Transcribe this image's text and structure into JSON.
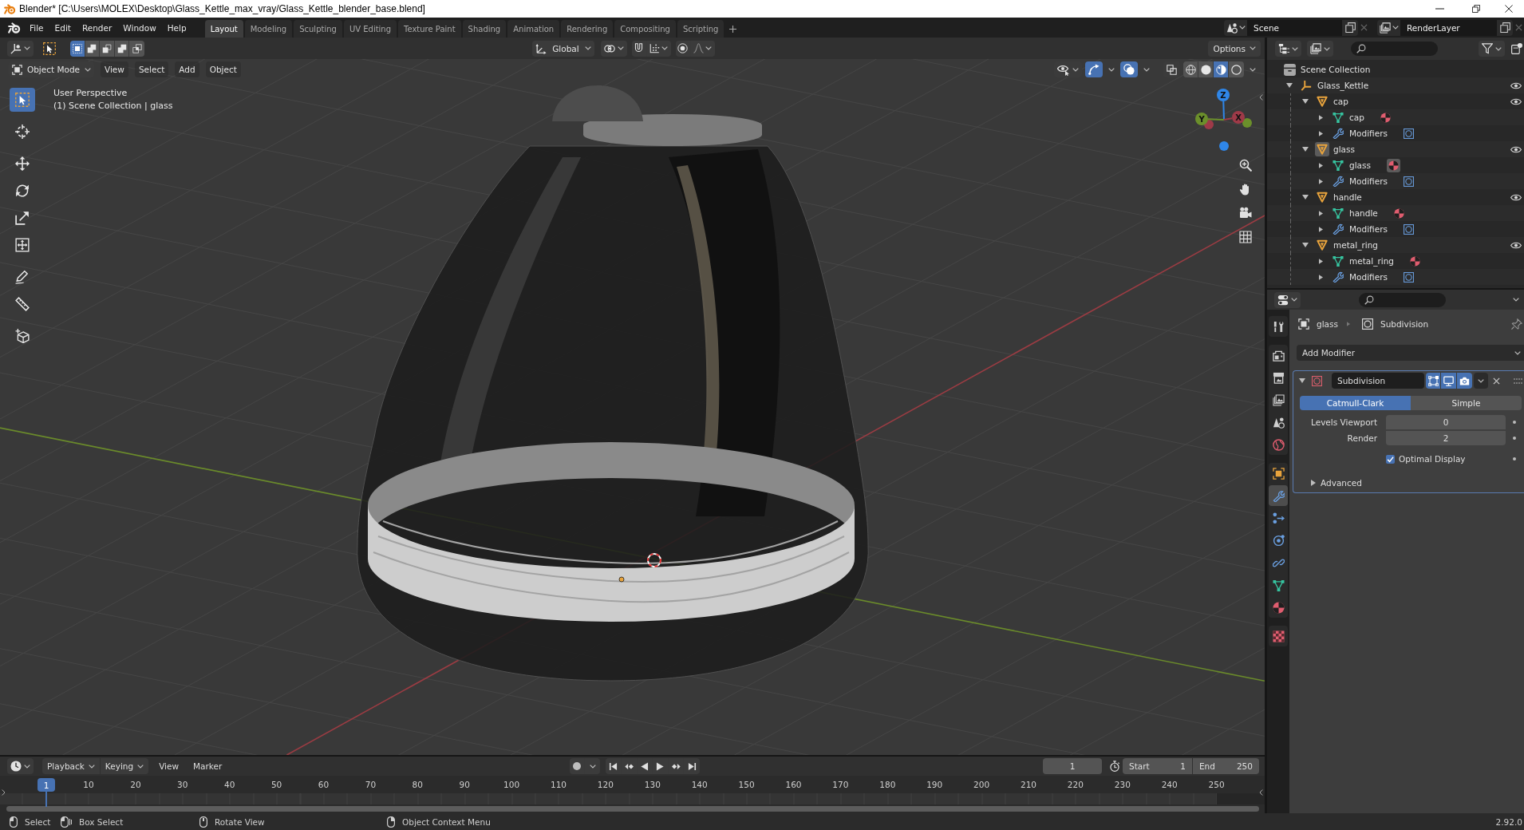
{
  "window": {
    "title": "Blender* [C:\\Users\\MOLEX\\Desktop\\Glass_Kettle_max_vray/Glass_Kettle_blender_base.blend]"
  },
  "menu": [
    "File",
    "Edit",
    "Render",
    "Window",
    "Help"
  ],
  "workspaces": [
    {
      "label": "Layout",
      "selected": true
    },
    {
      "label": "Modeling",
      "selected": false
    },
    {
      "label": "Sculpting",
      "selected": false
    },
    {
      "label": "UV Editing",
      "selected": false
    },
    {
      "label": "Texture Paint",
      "selected": false
    },
    {
      "label": "Shading",
      "selected": false
    },
    {
      "label": "Animation",
      "selected": false
    },
    {
      "label": "Rendering",
      "selected": false
    },
    {
      "label": "Compositing",
      "selected": false
    },
    {
      "label": "Scripting",
      "selected": false
    }
  ],
  "scene": {
    "name": "Scene",
    "view_layer": "RenderLayer"
  },
  "tool_settings": {
    "select_modes": [
      {
        "kind": "set",
        "selected": true
      },
      {
        "kind": "extend",
        "selected": false
      },
      {
        "kind": "subtract",
        "selected": false
      },
      {
        "kind": "difference",
        "selected": false
      },
      {
        "kind": "intersect",
        "selected": false
      }
    ],
    "orientation": "Global",
    "options": "Options"
  },
  "viewport": {
    "mode": "Object Mode",
    "menus": [
      "View",
      "Select",
      "Add",
      "Object"
    ],
    "gizmos": true,
    "overlays": true,
    "xray": false,
    "shading": [
      {
        "kind": "wireframe",
        "selected": false
      },
      {
        "kind": "solid",
        "selected": false
      },
      {
        "kind": "material",
        "selected": true
      },
      {
        "kind": "rendered",
        "selected": false
      }
    ],
    "toolbar": [
      [
        {
          "kind": "select_box",
          "selected": true
        }
      ],
      [
        {
          "kind": "cursor",
          "selected": false
        }
      ],
      [
        {
          "kind": "move",
          "selected": false
        },
        {
          "kind": "rotate",
          "selected": false
        },
        {
          "kind": "scale",
          "selected": false
        },
        {
          "kind": "transform",
          "selected": false
        }
      ],
      [
        {
          "kind": "annotate",
          "selected": false
        },
        {
          "kind": "measure",
          "selected": false
        }
      ],
      [
        {
          "kind": "add_cube",
          "selected": false
        }
      ]
    ],
    "info": [
      "User Perspective",
      "(1) Scene Collection | glass"
    ],
    "navigation_gizmo": {
      "axes": [
        {
          "label": "X",
          "color": "#9e3a48"
        },
        {
          "label": "Y",
          "color": "#6b8f2b"
        },
        {
          "label": "Z",
          "color": "#2f86e8"
        }
      ]
    }
  },
  "outliner": {
    "root": {
      "label": "Scene Collection",
      "children": [
        {
          "kind": "empty",
          "label": "Glass_Kettle",
          "expanded": true,
          "visible": true,
          "active": false,
          "children": [
            {
              "kind": "object",
              "label": "cap",
              "expanded": true,
              "visible": true,
              "active": false,
              "children": [
                {
                  "kind": "mesh",
                  "label": "cap",
                  "expanded": false,
                  "active": false
                },
                {
                  "kind": "modifiers",
                  "label": "Modifiers",
                  "expanded": false,
                  "active": false
                }
              ]
            },
            {
              "kind": "object",
              "label": "glass",
              "expanded": true,
              "visible": true,
              "active": true,
              "children": [
                {
                  "kind": "mesh",
                  "label": "glass",
                  "expanded": false,
                  "active": true
                },
                {
                  "kind": "modifiers",
                  "label": "Modifiers",
                  "expanded": false,
                  "active": false
                }
              ]
            },
            {
              "kind": "object",
              "label": "handle",
              "expanded": true,
              "visible": true,
              "active": false,
              "children": [
                {
                  "kind": "mesh",
                  "label": "handle",
                  "expanded": false,
                  "active": false
                },
                {
                  "kind": "modifiers",
                  "label": "Modifiers",
                  "expanded": false,
                  "active": false
                }
              ]
            },
            {
              "kind": "object",
              "label": "metal_ring",
              "expanded": true,
              "visible": true,
              "active": false,
              "children": [
                {
                  "kind": "mesh",
                  "label": "metal_ring",
                  "expanded": false,
                  "active": false
                },
                {
                  "kind": "modifiers",
                  "label": "Modifiers",
                  "expanded": false,
                  "active": false
                }
              ]
            }
          ]
        }
      ]
    }
  },
  "properties": {
    "tabs": [
      [
        {
          "kind": "tool",
          "selected": false
        }
      ],
      [
        {
          "kind": "render",
          "selected": false
        },
        {
          "kind": "output",
          "selected": false
        },
        {
          "kind": "view_layer",
          "selected": false
        },
        {
          "kind": "scene",
          "selected": false
        },
        {
          "kind": "world",
          "selected": false
        }
      ],
      [
        {
          "kind": "object",
          "selected": false
        },
        {
          "kind": "modifiers",
          "selected": true
        },
        {
          "kind": "particles",
          "selected": false
        },
        {
          "kind": "physics",
          "selected": false
        },
        {
          "kind": "constraints",
          "selected": false
        },
        {
          "kind": "data",
          "selected": false
        },
        {
          "kind": "material",
          "selected": false
        }
      ],
      [
        {
          "kind": "texture",
          "selected": false
        }
      ]
    ],
    "context": {
      "object": "glass",
      "modifier": "Subdivision"
    },
    "add_modifier": "Add Modifier",
    "modifiers": [
      {
        "name": "Subdivision",
        "expanded": true,
        "edit_mode": true,
        "viewport": true,
        "render": true,
        "types": [
          {
            "label": "Catmull-Clark",
            "selected": true
          },
          {
            "label": "Simple",
            "selected": false
          }
        ],
        "fields": [
          {
            "label": "Levels Viewport",
            "value": "0"
          },
          {
            "label": "Render",
            "value": "2"
          }
        ],
        "options": [
          {
            "label": "Optimal Display",
            "checked": true
          }
        ],
        "sections": [
          {
            "label": "Advanced",
            "expanded": false
          }
        ]
      }
    ]
  },
  "timeline": {
    "menus": [
      {
        "kind": "dropdown",
        "label": "Playback"
      },
      {
        "kind": "dropdown",
        "label": "Keying"
      },
      {
        "kind": "menu",
        "label": "View"
      },
      {
        "kind": "menu",
        "label": "Marker"
      }
    ],
    "current_frame": "1",
    "start": {
      "label": "Start",
      "value": "1"
    },
    "end": {
      "label": "End",
      "value": "250"
    },
    "playhead": "1",
    "ruler": [
      "10",
      "20",
      "30",
      "40",
      "50",
      "60",
      "70",
      "80",
      "90",
      "100",
      "110",
      "120",
      "130",
      "140",
      "150",
      "160",
      "170",
      "180",
      "190",
      "200",
      "210",
      "220",
      "230",
      "240",
      "250"
    ]
  },
  "status_bar": {
    "hints": [
      {
        "kind": "left_click",
        "label": "Select"
      },
      {
        "kind": "left_drag",
        "label": "Box Select"
      },
      {
        "kind": "middle_click",
        "label": "Rotate View"
      },
      {
        "kind": "right_click",
        "label": "Object Context Menu"
      }
    ],
    "version": "2.92.0"
  }
}
